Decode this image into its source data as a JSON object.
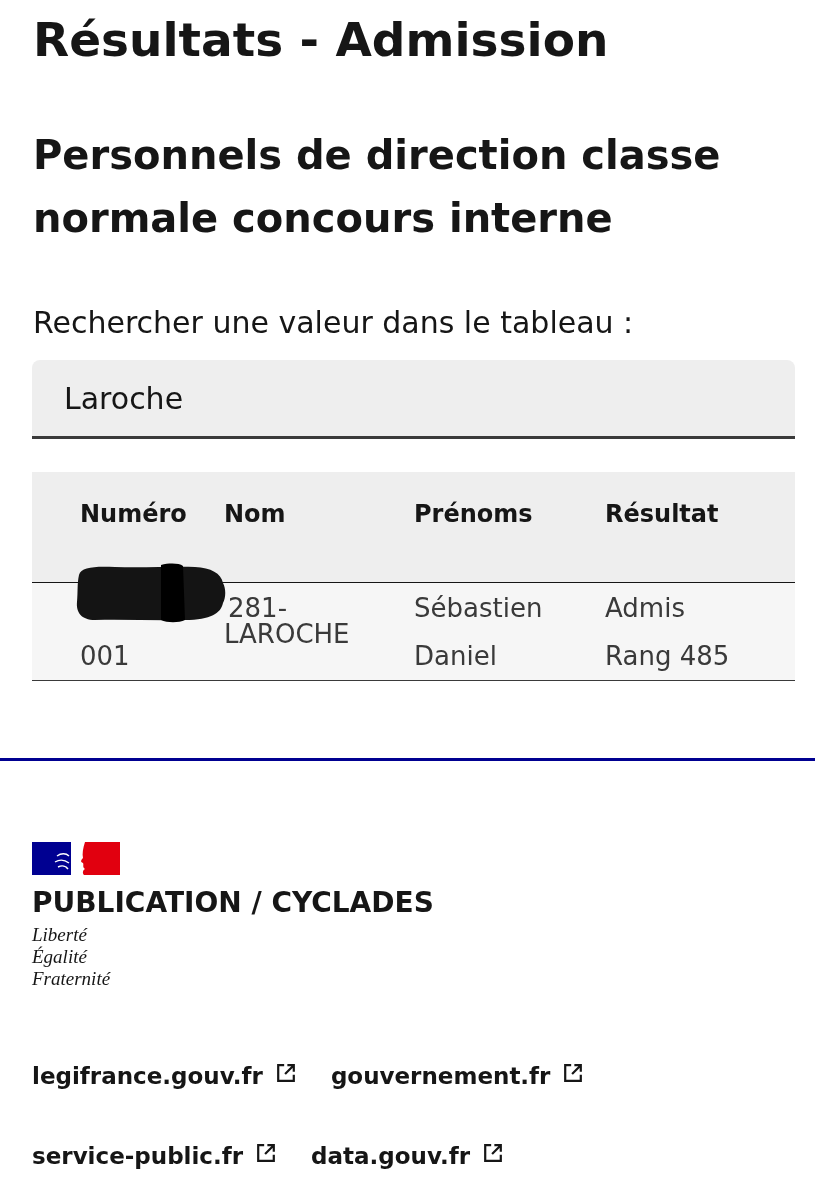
{
  "page": {
    "title": "Résultats - Admission",
    "subtitle": "Personnels de direction classe normale concours interne"
  },
  "search": {
    "label": "Rechercher une valeur dans le tableau :",
    "value": "Laroche"
  },
  "table": {
    "columns": [
      "Numéro",
      "Nom",
      "Prénoms",
      "Résultat"
    ],
    "rows": [
      {
        "numero": [
          "281-",
          "001"
        ],
        "nom": "LAROCHE",
        "prenoms": "Sébastien Daniel",
        "resultat": [
          "Admis",
          "Rang 485"
        ],
        "redacted": true
      }
    ]
  },
  "footer": {
    "brand": "PUBLICATION / CYCLADES",
    "motto": [
      "Liberté",
      "Égalité",
      "Fraternité"
    ],
    "links": [
      "legifrance.gouv.fr",
      "gouvernement.fr",
      "service-public.fr",
      "data.gouv.fr"
    ]
  }
}
